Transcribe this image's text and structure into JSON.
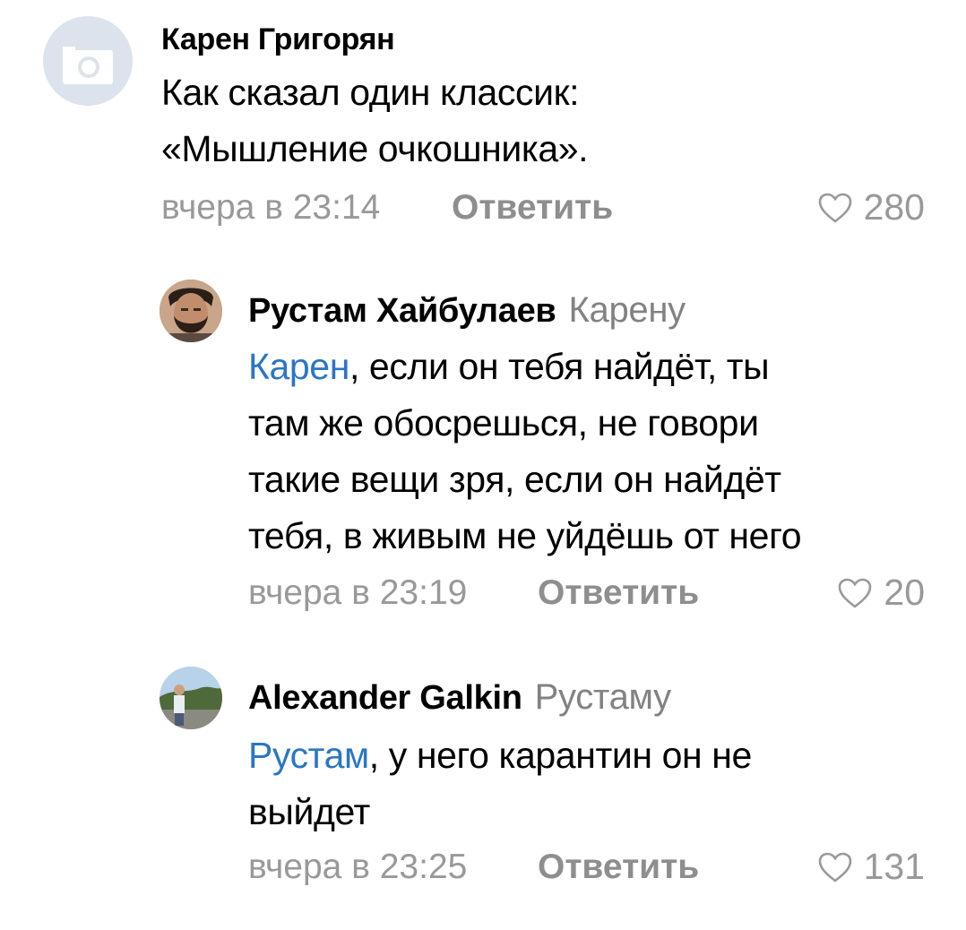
{
  "comments": [
    {
      "author": "Карен Григорян",
      "reply_to": "",
      "mention": "",
      "lines": [
        "Как сказал один  классик:",
        "«Мышление очкошника»."
      ],
      "time": "вчера в 23:14",
      "reply_label": "Ответить",
      "likes": "280",
      "avatar": "camera-placeholder-icon"
    },
    {
      "author": "Рустам Хайбулаев",
      "reply_to": "Карену",
      "mention": "Карен",
      "lines": [
        ", если он тебя найдёт, ты",
        "там же обосрешься, не говори",
        "такие вещи зря, если он найдёт",
        "тебя, в живым не уйдёшь от него"
      ],
      "time": "вчера в 23:19",
      "reply_label": "Ответить",
      "likes": "20",
      "avatar": "user-photo"
    },
    {
      "author": "Alexander Galkin",
      "reply_to": "Рустаму",
      "mention": "Рустам",
      "lines": [
        ", у него карантин он не",
        "выйдет"
      ],
      "time": "вчера в 23:25",
      "reply_label": "Ответить",
      "likes": "131",
      "avatar": "user-photo"
    }
  ],
  "colors": {
    "mention": "#2a76c6",
    "meta": "#999999",
    "reply": "#8e8e8e",
    "avatar_placeholder": "#dce3ec"
  }
}
